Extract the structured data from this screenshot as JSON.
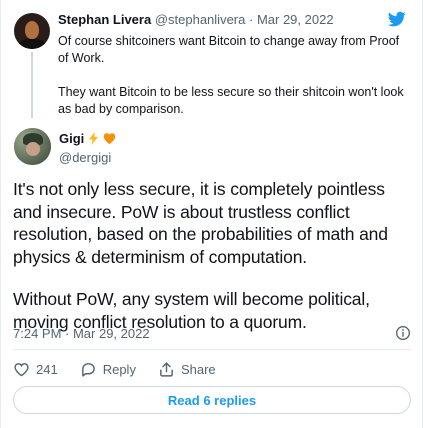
{
  "parent_tweet": {
    "name": "Stephan Livera",
    "handle": "@stephanlivera",
    "separator": "·",
    "date": "Mar 29, 2022",
    "paragraphs": [
      "Of course shitcoiners want Bitcoin to change away from Proof of Work.",
      "They want Bitcoin to be less secure so their shitcoin won't look as bad by comparison."
    ]
  },
  "main_tweet": {
    "name": "Gigi",
    "handle": "@dergigi",
    "paragraphs": [
      "It's not only less secure, it is completely pointless and insecure. PoW is about trustless conflict resolution, based on the probabilities of math and physics & determinism of computation.",
      "Without PoW, any system will become political, moving conflict resolution to a quorum."
    ],
    "timestamp": "7:24 PM · Mar 29, 2022"
  },
  "actions": {
    "like_count": "241",
    "reply_label": "Reply",
    "share_label": "Share"
  },
  "read_replies_label": "Read 6 replies",
  "icons": {
    "brand": "twitter-bird-icon",
    "emoji_1": "lightning-emoji",
    "emoji_2": "orange-heart-emoji",
    "info": "info-icon",
    "like": "heart-icon",
    "reply": "reply-bubble-icon",
    "share": "share-icon"
  },
  "colors": {
    "accent": "#1d9bf0",
    "secondary_text": "#536471",
    "primary_text": "#0f1419",
    "divider": "#e6ecf0"
  }
}
